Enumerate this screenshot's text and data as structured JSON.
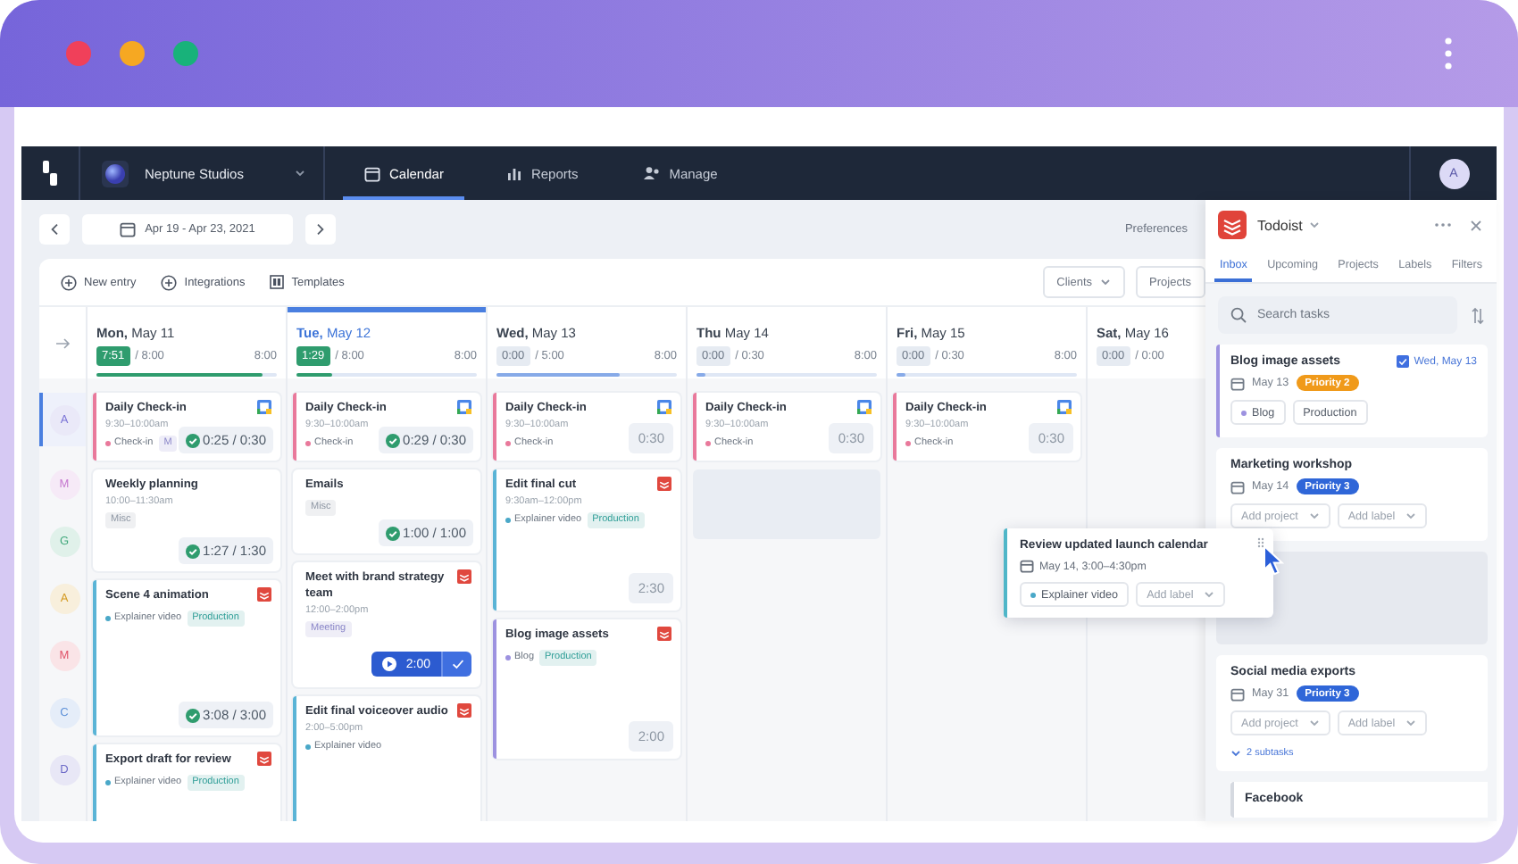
{
  "nav": {
    "workspace": "Neptune Studios",
    "tabs": [
      {
        "label": "Calendar",
        "selected": true
      },
      {
        "label": "Reports",
        "selected": false
      },
      {
        "label": "Manage",
        "selected": false
      }
    ],
    "user": "A"
  },
  "toolbar": {
    "date_range": "Apr 19 - Apr 23, 2021",
    "preferences": "Preferences"
  },
  "actions": [
    "New entry",
    "Integrations",
    "Templates"
  ],
  "filters": [
    {
      "label": "Clients",
      "caret": true
    },
    {
      "label": "Projects",
      "caret": false
    }
  ],
  "people": [
    {
      "initial": "A",
      "color": "#7b74d6",
      "selected": true
    },
    {
      "initial": "M",
      "color": "#c77ad0",
      "selected": false
    },
    {
      "initial": "G",
      "color": "#3fa77a",
      "selected": false
    },
    {
      "initial": "A",
      "color": "#d49a22",
      "selected": false
    },
    {
      "initial": "M",
      "color": "#e0566c",
      "selected": false
    },
    {
      "initial": "C",
      "color": "#5b8fd8",
      "selected": false
    },
    {
      "initial": "D",
      "color": "#6f6cc8",
      "selected": false
    }
  ],
  "days": [
    {
      "weekday": "Mon,",
      "date": "May 11",
      "tracked": "7:51",
      "planned": "/ 8:00",
      "capacity": "8:00",
      "logged": true,
      "selected": false,
      "level": 0.92,
      "events": [
        {
          "kind": "calendar",
          "title": "Daily Check-in",
          "time": "9:30–10:00am",
          "color": "#e9799b",
          "tags": [
            {
              "kind": "project",
              "label": "Check-in",
              "color": "#e9799b"
            },
            {
              "kind": "label",
              "label": "M"
            }
          ],
          "tracking": {
            "kind": "tracked",
            "text": "0:25 / 0:30"
          }
        },
        {
          "kind": "entry",
          "title": "Weekly planning",
          "time": "10:00–11:30am",
          "tags": [
            {
              "kind": "label",
              "label": "Misc",
              "color": "#8d96a3"
            }
          ],
          "tracking": {
            "kind": "tracked",
            "text": "1:27 / 1:30"
          }
        },
        {
          "kind": "task",
          "title": "Scene 4 animation",
          "color": "#5ab4d6",
          "tags": [
            {
              "kind": "project",
              "label": "Explainer video",
              "color": "#4aa8c8"
            },
            {
              "kind": "label",
              "label": "Production",
              "color": "#2f9e97"
            }
          ],
          "tracking": {
            "kind": "tracked",
            "text": "3:08 / 3:00"
          }
        },
        {
          "kind": "task",
          "title": "Export draft for review",
          "color": "#5ab4d6",
          "tags": [
            {
              "kind": "project",
              "label": "Explainer video",
              "color": "#4aa8c8"
            },
            {
              "kind": "label",
              "label": "Production",
              "color": "#2f9e97"
            }
          ]
        }
      ]
    },
    {
      "weekday": "Tue,",
      "date": "May 12",
      "tracked": "1:29",
      "planned": "/ 8:00",
      "capacity": "8:00",
      "logged": true,
      "selected": true,
      "level": 0.2,
      "events": [
        {
          "kind": "calendar",
          "title": "Daily Check-in",
          "time": "9:30–10:00am",
          "color": "#e9799b",
          "tags": [
            {
              "kind": "project",
              "label": "Check-in",
              "color": "#e9799b"
            }
          ],
          "tracking": {
            "kind": "tracked",
            "text": "0:29 / 0:30"
          }
        },
        {
          "kind": "entry",
          "title": "Emails",
          "tags": [
            {
              "kind": "label",
              "label": "Misc",
              "color": "#8d96a3"
            }
          ],
          "tracking": {
            "kind": "tracked",
            "text": "1:00 / 1:00"
          }
        },
        {
          "kind": "task",
          "title": "Meet with brand strategy team",
          "time": "12:00–2:00pm",
          "tags": [
            {
              "kind": "label",
              "label": "Meeting",
              "color": "#8a86c8"
            }
          ],
          "tracking": {
            "kind": "timer",
            "text": "2:00"
          }
        },
        {
          "kind": "task",
          "title": "Edit final voiceover audio",
          "time": "2:00–5:00pm",
          "color": "#5ab4d6",
          "tags": [
            {
              "kind": "project",
              "label": "Explainer video",
              "color": "#4aa8c8"
            }
          ]
        }
      ]
    },
    {
      "weekday": "Wed,",
      "date": "May 13",
      "tracked": "0:00",
      "planned": "/ 5:00",
      "capacity": "8:00",
      "logged": false,
      "selected": false,
      "level": 0.68,
      "events": [
        {
          "kind": "calendar",
          "title": "Daily Check-in",
          "time": "9:30–10:00am",
          "color": "#e9799b",
          "tags": [
            {
              "kind": "project",
              "label": "Check-in",
              "color": "#e9799b"
            }
          ],
          "tracking": {
            "kind": "planned",
            "text": "0:30"
          }
        },
        {
          "kind": "task",
          "title": "Edit final cut",
          "time": "9:30am–12:00pm",
          "color": "#5ab4d6",
          "tags": [
            {
              "kind": "project",
              "label": "Explainer video",
              "color": "#4aa8c8"
            },
            {
              "kind": "label",
              "label": "Production",
              "color": "#2f9e97"
            }
          ],
          "tracking": {
            "kind": "planned",
            "text": "2:30"
          }
        },
        {
          "kind": "task",
          "title": "Blog image assets",
          "color": "#9d92e0",
          "tags": [
            {
              "kind": "project",
              "label": "Blog",
              "color": "#9d92e0"
            },
            {
              "kind": "label",
              "label": "Production",
              "color": "#2f9e97"
            }
          ],
          "tracking": {
            "kind": "planned",
            "text": "2:00"
          }
        }
      ]
    },
    {
      "weekday": "Thu",
      "date": "May 14",
      "tracked": "0:00",
      "planned": "/ 0:30",
      "capacity": "8:00",
      "logged": false,
      "selected": false,
      "level": 0.05,
      "events": [
        {
          "kind": "calendar",
          "title": "Daily Check-in",
          "time": "9:30–10:00am",
          "color": "#e9799b",
          "tags": [
            {
              "kind": "project",
              "label": "Check-in",
              "color": "#e9799b"
            }
          ],
          "tracking": {
            "kind": "planned",
            "text": "0:30"
          }
        },
        {
          "kind": "empty"
        }
      ]
    },
    {
      "weekday": "Fri,",
      "date": "May 15",
      "tracked": "0:00",
      "planned": "/ 0:30",
      "capacity": "8:00",
      "logged": false,
      "selected": false,
      "level": 0.05,
      "events": [
        {
          "kind": "calendar",
          "title": "Daily Check-in",
          "time": "9:30–10:00am",
          "color": "#e9799b",
          "tags": [
            {
              "kind": "project",
              "label": "Check-in",
              "color": "#e9799b"
            }
          ],
          "tracking": {
            "kind": "planned",
            "text": "0:30"
          }
        }
      ]
    },
    {
      "weekday": "Sat,",
      "date": "May 16",
      "tracked": "0:00",
      "planned": "/ 0:00",
      "logged": false,
      "selected": false
    }
  ],
  "drag_card": {
    "title": "Review updated launch calendar",
    "when": "May 14, 3:00–4:30pm",
    "color": "#4fb6c8",
    "chips": [
      {
        "kind": "project",
        "label": "Explainer video",
        "color": "#4aa8c8"
      },
      {
        "kind": "add",
        "label": "Add label"
      }
    ]
  },
  "todoist": {
    "app": "Todoist",
    "tabs": [
      {
        "label": "Inbox",
        "selected": true
      },
      {
        "label": "Upcoming",
        "selected": false
      },
      {
        "label": "Projects",
        "selected": false
      },
      {
        "label": "Labels",
        "selected": false
      },
      {
        "label": "Filters",
        "selected": false
      }
    ],
    "search": {
      "placeholder": "Search tasks"
    },
    "tasks": [
      {
        "kind": "task",
        "title": "Blog image assets",
        "color": "#9d92e0",
        "scheduled": "Wed, May 13",
        "date": "May 13",
        "priority": {
          "label": "Priority 2",
          "color": "#f09a1a"
        },
        "chips": [
          {
            "kind": "project",
            "label": "Blog",
            "color": "#9d92e0"
          },
          {
            "kind": "label",
            "label": "Production"
          }
        ]
      },
      {
        "kind": "task",
        "title": "Marketing workshop",
        "date": "May 14",
        "priority": {
          "label": "Priority 3",
          "color": "#2f66d8"
        },
        "chips": [
          {
            "kind": "add",
            "label": "Add project"
          },
          {
            "kind": "add",
            "label": "Add label"
          }
        ]
      },
      {
        "kind": "empty"
      },
      {
        "kind": "task",
        "title": "Social media exports",
        "date": "May 31",
        "priority": {
          "label": "Priority 3",
          "color": "#2f66d8"
        },
        "chips": [
          {
            "kind": "add",
            "label": "Add project"
          },
          {
            "kind": "add",
            "label": "Add label"
          }
        ],
        "subtasks": "2 subtasks"
      },
      {
        "kind": "subtask",
        "title": "Facebook"
      }
    ]
  }
}
